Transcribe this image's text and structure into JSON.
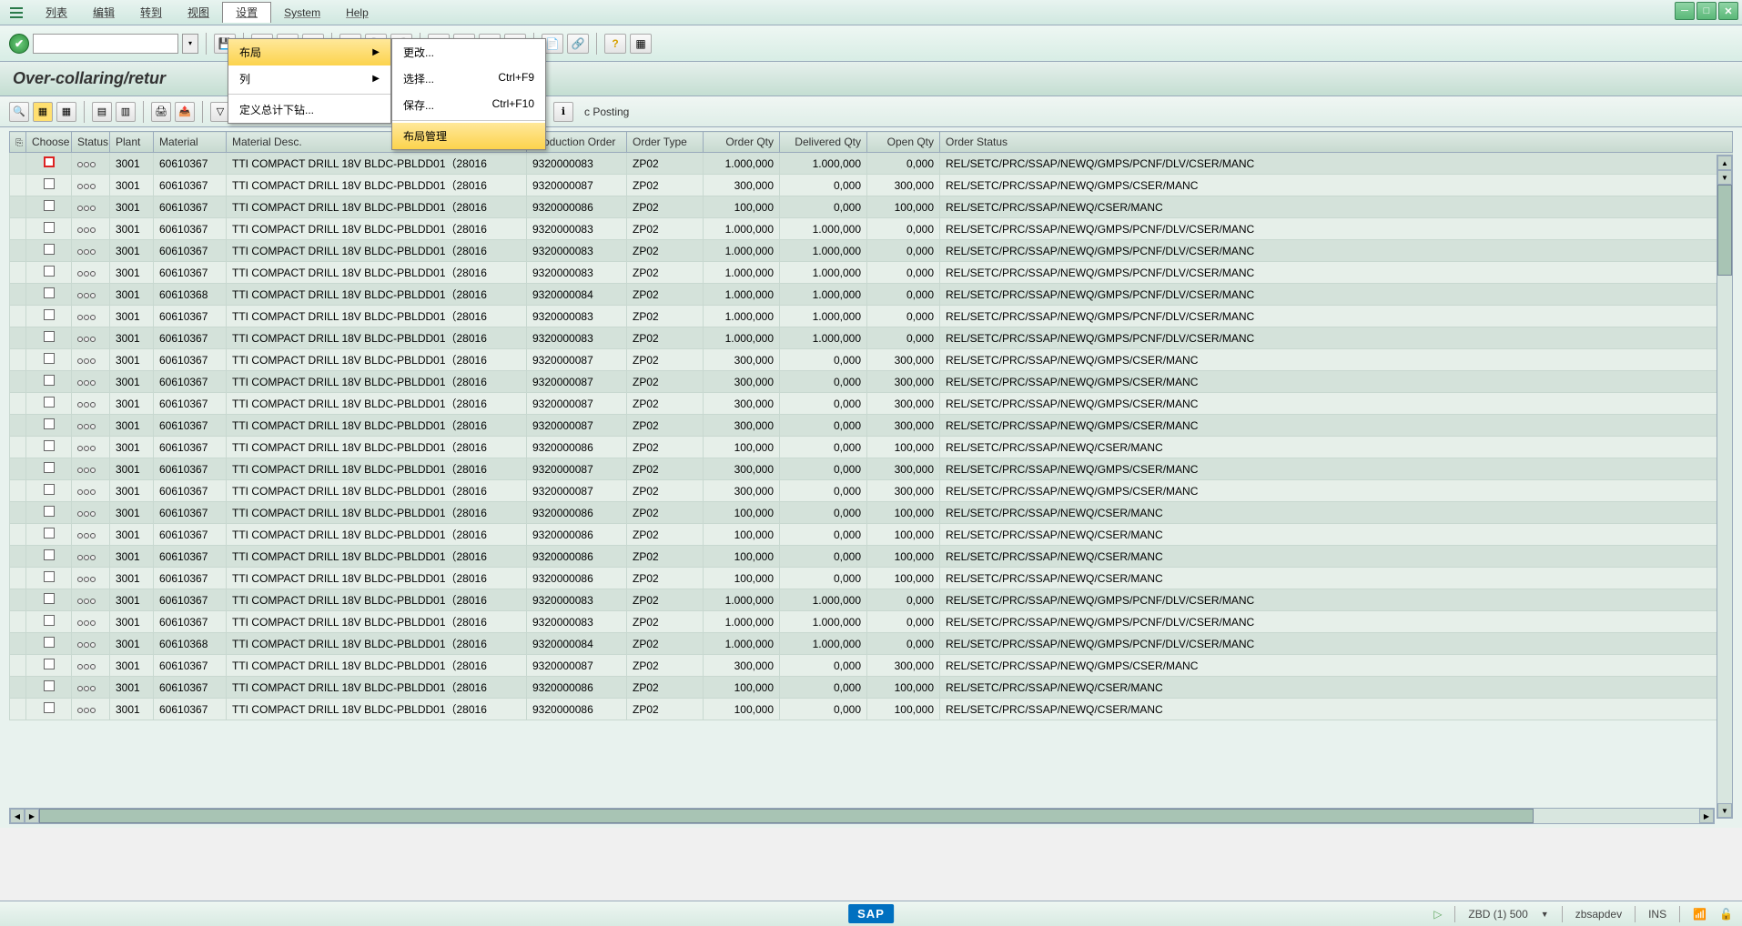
{
  "menubar": {
    "items": [
      "列表",
      "编辑",
      "转到",
      "视图",
      "设置",
      "System",
      "Help"
    ]
  },
  "title": "Over-collaring/retur",
  "dropdown1": {
    "items": [
      {
        "label": "布局",
        "arrow": true,
        "hl": true
      },
      {
        "label": "列",
        "arrow": true
      },
      {
        "label": "定义总计下钻..."
      }
    ]
  },
  "dropdown2": {
    "items": [
      {
        "label": "更改...",
        "shortcut": ""
      },
      {
        "label": "选择...",
        "shortcut": "Ctrl+F9"
      },
      {
        "label": "保存...",
        "shortcut": "Ctrl+F10"
      },
      {
        "label": "布局管理",
        "shortcut": "",
        "hl": true
      }
    ]
  },
  "toolbar2_text": "c Posting",
  "columns": [
    "",
    "Choose",
    "Status",
    "Plant",
    "Material",
    "Material Desc.",
    "Production Order",
    "Order Type",
    "Order Qty",
    "Delivered Qty",
    "Open Qty",
    "Order Status"
  ],
  "rows": [
    {
      "chk_red": true,
      "plant": "3001",
      "material": "60610367",
      "desc": "TTI COMPACT DRILL 18V BLDC-PBLDD01（28016",
      "prod": "9320000083",
      "otype": "ZP02",
      "oqty": "1.000,000",
      "dqty": "1.000,000",
      "opqty": "0,000",
      "status": "REL/SETC/PRC/SSAP/NEWQ/GMPS/PCNF/DLV/CSER/MANC"
    },
    {
      "plant": "3001",
      "material": "60610367",
      "desc": "TTI COMPACT DRILL 18V BLDC-PBLDD01（28016",
      "prod": "9320000087",
      "otype": "ZP02",
      "oqty": "300,000",
      "dqty": "0,000",
      "opqty": "300,000",
      "status": "REL/SETC/PRC/SSAP/NEWQ/GMPS/CSER/MANC"
    },
    {
      "plant": "3001",
      "material": "60610367",
      "desc": "TTI COMPACT DRILL 18V BLDC-PBLDD01（28016",
      "prod": "9320000086",
      "otype": "ZP02",
      "oqty": "100,000",
      "dqty": "0,000",
      "opqty": "100,000",
      "status": "REL/SETC/PRC/SSAP/NEWQ/CSER/MANC"
    },
    {
      "plant": "3001",
      "material": "60610367",
      "desc": "TTI COMPACT DRILL 18V BLDC-PBLDD01（28016",
      "prod": "9320000083",
      "otype": "ZP02",
      "oqty": "1.000,000",
      "dqty": "1.000,000",
      "opqty": "0,000",
      "status": "REL/SETC/PRC/SSAP/NEWQ/GMPS/PCNF/DLV/CSER/MANC"
    },
    {
      "plant": "3001",
      "material": "60610367",
      "desc": "TTI COMPACT DRILL 18V BLDC-PBLDD01（28016",
      "prod": "9320000083",
      "otype": "ZP02",
      "oqty": "1.000,000",
      "dqty": "1.000,000",
      "opqty": "0,000",
      "status": "REL/SETC/PRC/SSAP/NEWQ/GMPS/PCNF/DLV/CSER/MANC"
    },
    {
      "plant": "3001",
      "material": "60610367",
      "desc": "TTI COMPACT DRILL 18V BLDC-PBLDD01（28016",
      "prod": "9320000083",
      "otype": "ZP02",
      "oqty": "1.000,000",
      "dqty": "1.000,000",
      "opqty": "0,000",
      "status": "REL/SETC/PRC/SSAP/NEWQ/GMPS/PCNF/DLV/CSER/MANC"
    },
    {
      "plant": "3001",
      "material": "60610368",
      "desc": "TTI COMPACT DRILL 18V BLDC-PBLDD01（28016",
      "prod": "9320000084",
      "otype": "ZP02",
      "oqty": "1.000,000",
      "dqty": "1.000,000",
      "opqty": "0,000",
      "status": "REL/SETC/PRC/SSAP/NEWQ/GMPS/PCNF/DLV/CSER/MANC"
    },
    {
      "plant": "3001",
      "material": "60610367",
      "desc": "TTI COMPACT DRILL 18V BLDC-PBLDD01（28016",
      "prod": "9320000083",
      "otype": "ZP02",
      "oqty": "1.000,000",
      "dqty": "1.000,000",
      "opqty": "0,000",
      "status": "REL/SETC/PRC/SSAP/NEWQ/GMPS/PCNF/DLV/CSER/MANC"
    },
    {
      "plant": "3001",
      "material": "60610367",
      "desc": "TTI COMPACT DRILL 18V BLDC-PBLDD01（28016",
      "prod": "9320000083",
      "otype": "ZP02",
      "oqty": "1.000,000",
      "dqty": "1.000,000",
      "opqty": "0,000",
      "status": "REL/SETC/PRC/SSAP/NEWQ/GMPS/PCNF/DLV/CSER/MANC"
    },
    {
      "plant": "3001",
      "material": "60610367",
      "desc": "TTI COMPACT DRILL 18V BLDC-PBLDD01（28016",
      "prod": "9320000087",
      "otype": "ZP02",
      "oqty": "300,000",
      "dqty": "0,000",
      "opqty": "300,000",
      "status": "REL/SETC/PRC/SSAP/NEWQ/GMPS/CSER/MANC"
    },
    {
      "plant": "3001",
      "material": "60610367",
      "desc": "TTI COMPACT DRILL 18V BLDC-PBLDD01（28016",
      "prod": "9320000087",
      "otype": "ZP02",
      "oqty": "300,000",
      "dqty": "0,000",
      "opqty": "300,000",
      "status": "REL/SETC/PRC/SSAP/NEWQ/GMPS/CSER/MANC"
    },
    {
      "plant": "3001",
      "material": "60610367",
      "desc": "TTI COMPACT DRILL 18V BLDC-PBLDD01（28016",
      "prod": "9320000087",
      "otype": "ZP02",
      "oqty": "300,000",
      "dqty": "0,000",
      "opqty": "300,000",
      "status": "REL/SETC/PRC/SSAP/NEWQ/GMPS/CSER/MANC"
    },
    {
      "plant": "3001",
      "material": "60610367",
      "desc": "TTI COMPACT DRILL 18V BLDC-PBLDD01（28016",
      "prod": "9320000087",
      "otype": "ZP02",
      "oqty": "300,000",
      "dqty": "0,000",
      "opqty": "300,000",
      "status": "REL/SETC/PRC/SSAP/NEWQ/GMPS/CSER/MANC"
    },
    {
      "plant": "3001",
      "material": "60610367",
      "desc": "TTI COMPACT DRILL 18V BLDC-PBLDD01（28016",
      "prod": "9320000086",
      "otype": "ZP02",
      "oqty": "100,000",
      "dqty": "0,000",
      "opqty": "100,000",
      "status": "REL/SETC/PRC/SSAP/NEWQ/CSER/MANC"
    },
    {
      "plant": "3001",
      "material": "60610367",
      "desc": "TTI COMPACT DRILL 18V BLDC-PBLDD01（28016",
      "prod": "9320000087",
      "otype": "ZP02",
      "oqty": "300,000",
      "dqty": "0,000",
      "opqty": "300,000",
      "status": "REL/SETC/PRC/SSAP/NEWQ/GMPS/CSER/MANC"
    },
    {
      "plant": "3001",
      "material": "60610367",
      "desc": "TTI COMPACT DRILL 18V BLDC-PBLDD01（28016",
      "prod": "9320000087",
      "otype": "ZP02",
      "oqty": "300,000",
      "dqty": "0,000",
      "opqty": "300,000",
      "status": "REL/SETC/PRC/SSAP/NEWQ/GMPS/CSER/MANC"
    },
    {
      "plant": "3001",
      "material": "60610367",
      "desc": "TTI COMPACT DRILL 18V BLDC-PBLDD01（28016",
      "prod": "9320000086",
      "otype": "ZP02",
      "oqty": "100,000",
      "dqty": "0,000",
      "opqty": "100,000",
      "status": "REL/SETC/PRC/SSAP/NEWQ/CSER/MANC"
    },
    {
      "plant": "3001",
      "material": "60610367",
      "desc": "TTI COMPACT DRILL 18V BLDC-PBLDD01（28016",
      "prod": "9320000086",
      "otype": "ZP02",
      "oqty": "100,000",
      "dqty": "0,000",
      "opqty": "100,000",
      "status": "REL/SETC/PRC/SSAP/NEWQ/CSER/MANC"
    },
    {
      "plant": "3001",
      "material": "60610367",
      "desc": "TTI COMPACT DRILL 18V BLDC-PBLDD01（28016",
      "prod": "9320000086",
      "otype": "ZP02",
      "oqty": "100,000",
      "dqty": "0,000",
      "opqty": "100,000",
      "status": "REL/SETC/PRC/SSAP/NEWQ/CSER/MANC"
    },
    {
      "plant": "3001",
      "material": "60610367",
      "desc": "TTI COMPACT DRILL 18V BLDC-PBLDD01（28016",
      "prod": "9320000086",
      "otype": "ZP02",
      "oqty": "100,000",
      "dqty": "0,000",
      "opqty": "100,000",
      "status": "REL/SETC/PRC/SSAP/NEWQ/CSER/MANC"
    },
    {
      "plant": "3001",
      "material": "60610367",
      "desc": "TTI COMPACT DRILL 18V BLDC-PBLDD01（28016",
      "prod": "9320000083",
      "otype": "ZP02",
      "oqty": "1.000,000",
      "dqty": "1.000,000",
      "opqty": "0,000",
      "status": "REL/SETC/PRC/SSAP/NEWQ/GMPS/PCNF/DLV/CSER/MANC"
    },
    {
      "plant": "3001",
      "material": "60610367",
      "desc": "TTI COMPACT DRILL 18V BLDC-PBLDD01（28016",
      "prod": "9320000083",
      "otype": "ZP02",
      "oqty": "1.000,000",
      "dqty": "1.000,000",
      "opqty": "0,000",
      "status": "REL/SETC/PRC/SSAP/NEWQ/GMPS/PCNF/DLV/CSER/MANC"
    },
    {
      "plant": "3001",
      "material": "60610368",
      "desc": "TTI COMPACT DRILL 18V BLDC-PBLDD01（28016",
      "prod": "9320000084",
      "otype": "ZP02",
      "oqty": "1.000,000",
      "dqty": "1.000,000",
      "opqty": "0,000",
      "status": "REL/SETC/PRC/SSAP/NEWQ/GMPS/PCNF/DLV/CSER/MANC"
    },
    {
      "plant": "3001",
      "material": "60610367",
      "desc": "TTI COMPACT DRILL 18V BLDC-PBLDD01（28016",
      "prod": "9320000087",
      "otype": "ZP02",
      "oqty": "300,000",
      "dqty": "0,000",
      "opqty": "300,000",
      "status": "REL/SETC/PRC/SSAP/NEWQ/GMPS/CSER/MANC"
    },
    {
      "plant": "3001",
      "material": "60610367",
      "desc": "TTI COMPACT DRILL 18V BLDC-PBLDD01（28016",
      "prod": "9320000086",
      "otype": "ZP02",
      "oqty": "100,000",
      "dqty": "0,000",
      "opqty": "100,000",
      "status": "REL/SETC/PRC/SSAP/NEWQ/CSER/MANC"
    },
    {
      "plant": "3001",
      "material": "60610367",
      "desc": "TTI COMPACT DRILL 18V BLDC-PBLDD01（28016",
      "prod": "9320000086",
      "otype": "ZP02",
      "oqty": "100,000",
      "dqty": "0,000",
      "opqty": "100,000",
      "status": "REL/SETC/PRC/SSAP/NEWQ/CSER/MANC"
    }
  ],
  "status": {
    "sap": "SAP",
    "system": "ZBD (1) 500",
    "server": "zbsapdev",
    "ins": "INS"
  }
}
